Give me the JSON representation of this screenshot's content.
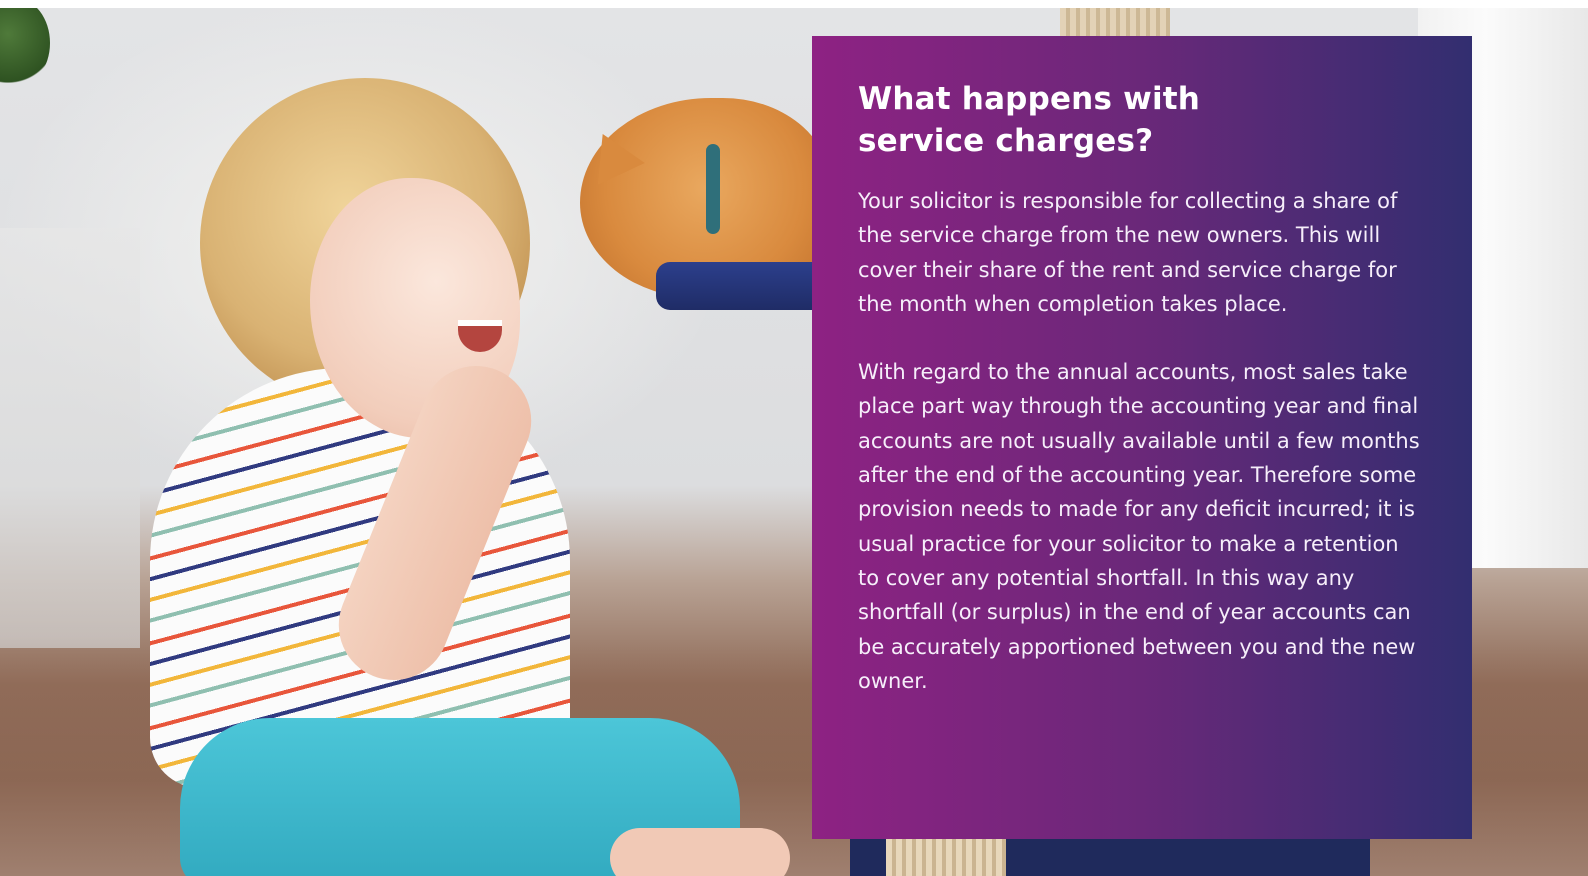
{
  "card": {
    "title": "What happens with service charges?",
    "paragraphs": [
      "Your solicitor is responsible for collecting a share of the service charge from the new owners. This will cover their share of the rent and service charge for the month when completion takes place.",
      "With regard to the annual accounts, most sales take place part way through the accounting year and final accounts are not usually available until a few months after the end of the accounting year. Therefore some provision needs to made for any deficit incurred; it is usual practice for your solicitor to make a retention to cover any potential shortfall. In this way any shortfall (or surplus) in the end of year accounts can be accurately apportioned between you and the new owner."
    ]
  },
  "colors": {
    "card_gradient_start": "#8e2283",
    "card_gradient_end": "#322e70",
    "text": "#ffffff"
  }
}
